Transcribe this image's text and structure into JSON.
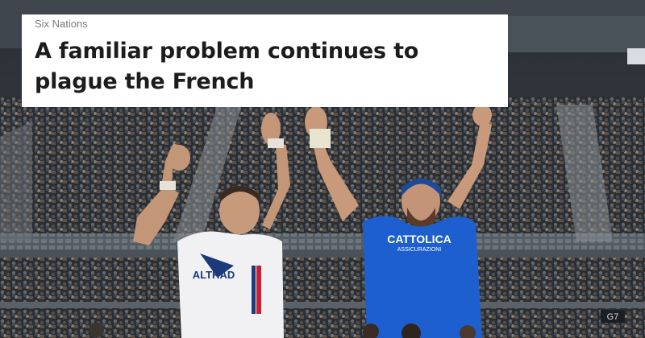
{
  "article": {
    "category": "Six Nations",
    "headline": "A familiar problem continues to plague the French"
  },
  "hero_image": {
    "jersey_left_sponsor": "ALTRAD",
    "jersey_right_sponsor_line1": "CATTOLICA",
    "jersey_right_sponsor_line2": "ASSICURAZIONI",
    "stadium_sign": "G7"
  },
  "colors": {
    "france_jersey": "#f1f1f4",
    "italy_jersey": "#1d5fcf",
    "card_background": "#ffffff",
    "headline_text": "#1c1c1c",
    "category_text": "#7a7a7a"
  }
}
